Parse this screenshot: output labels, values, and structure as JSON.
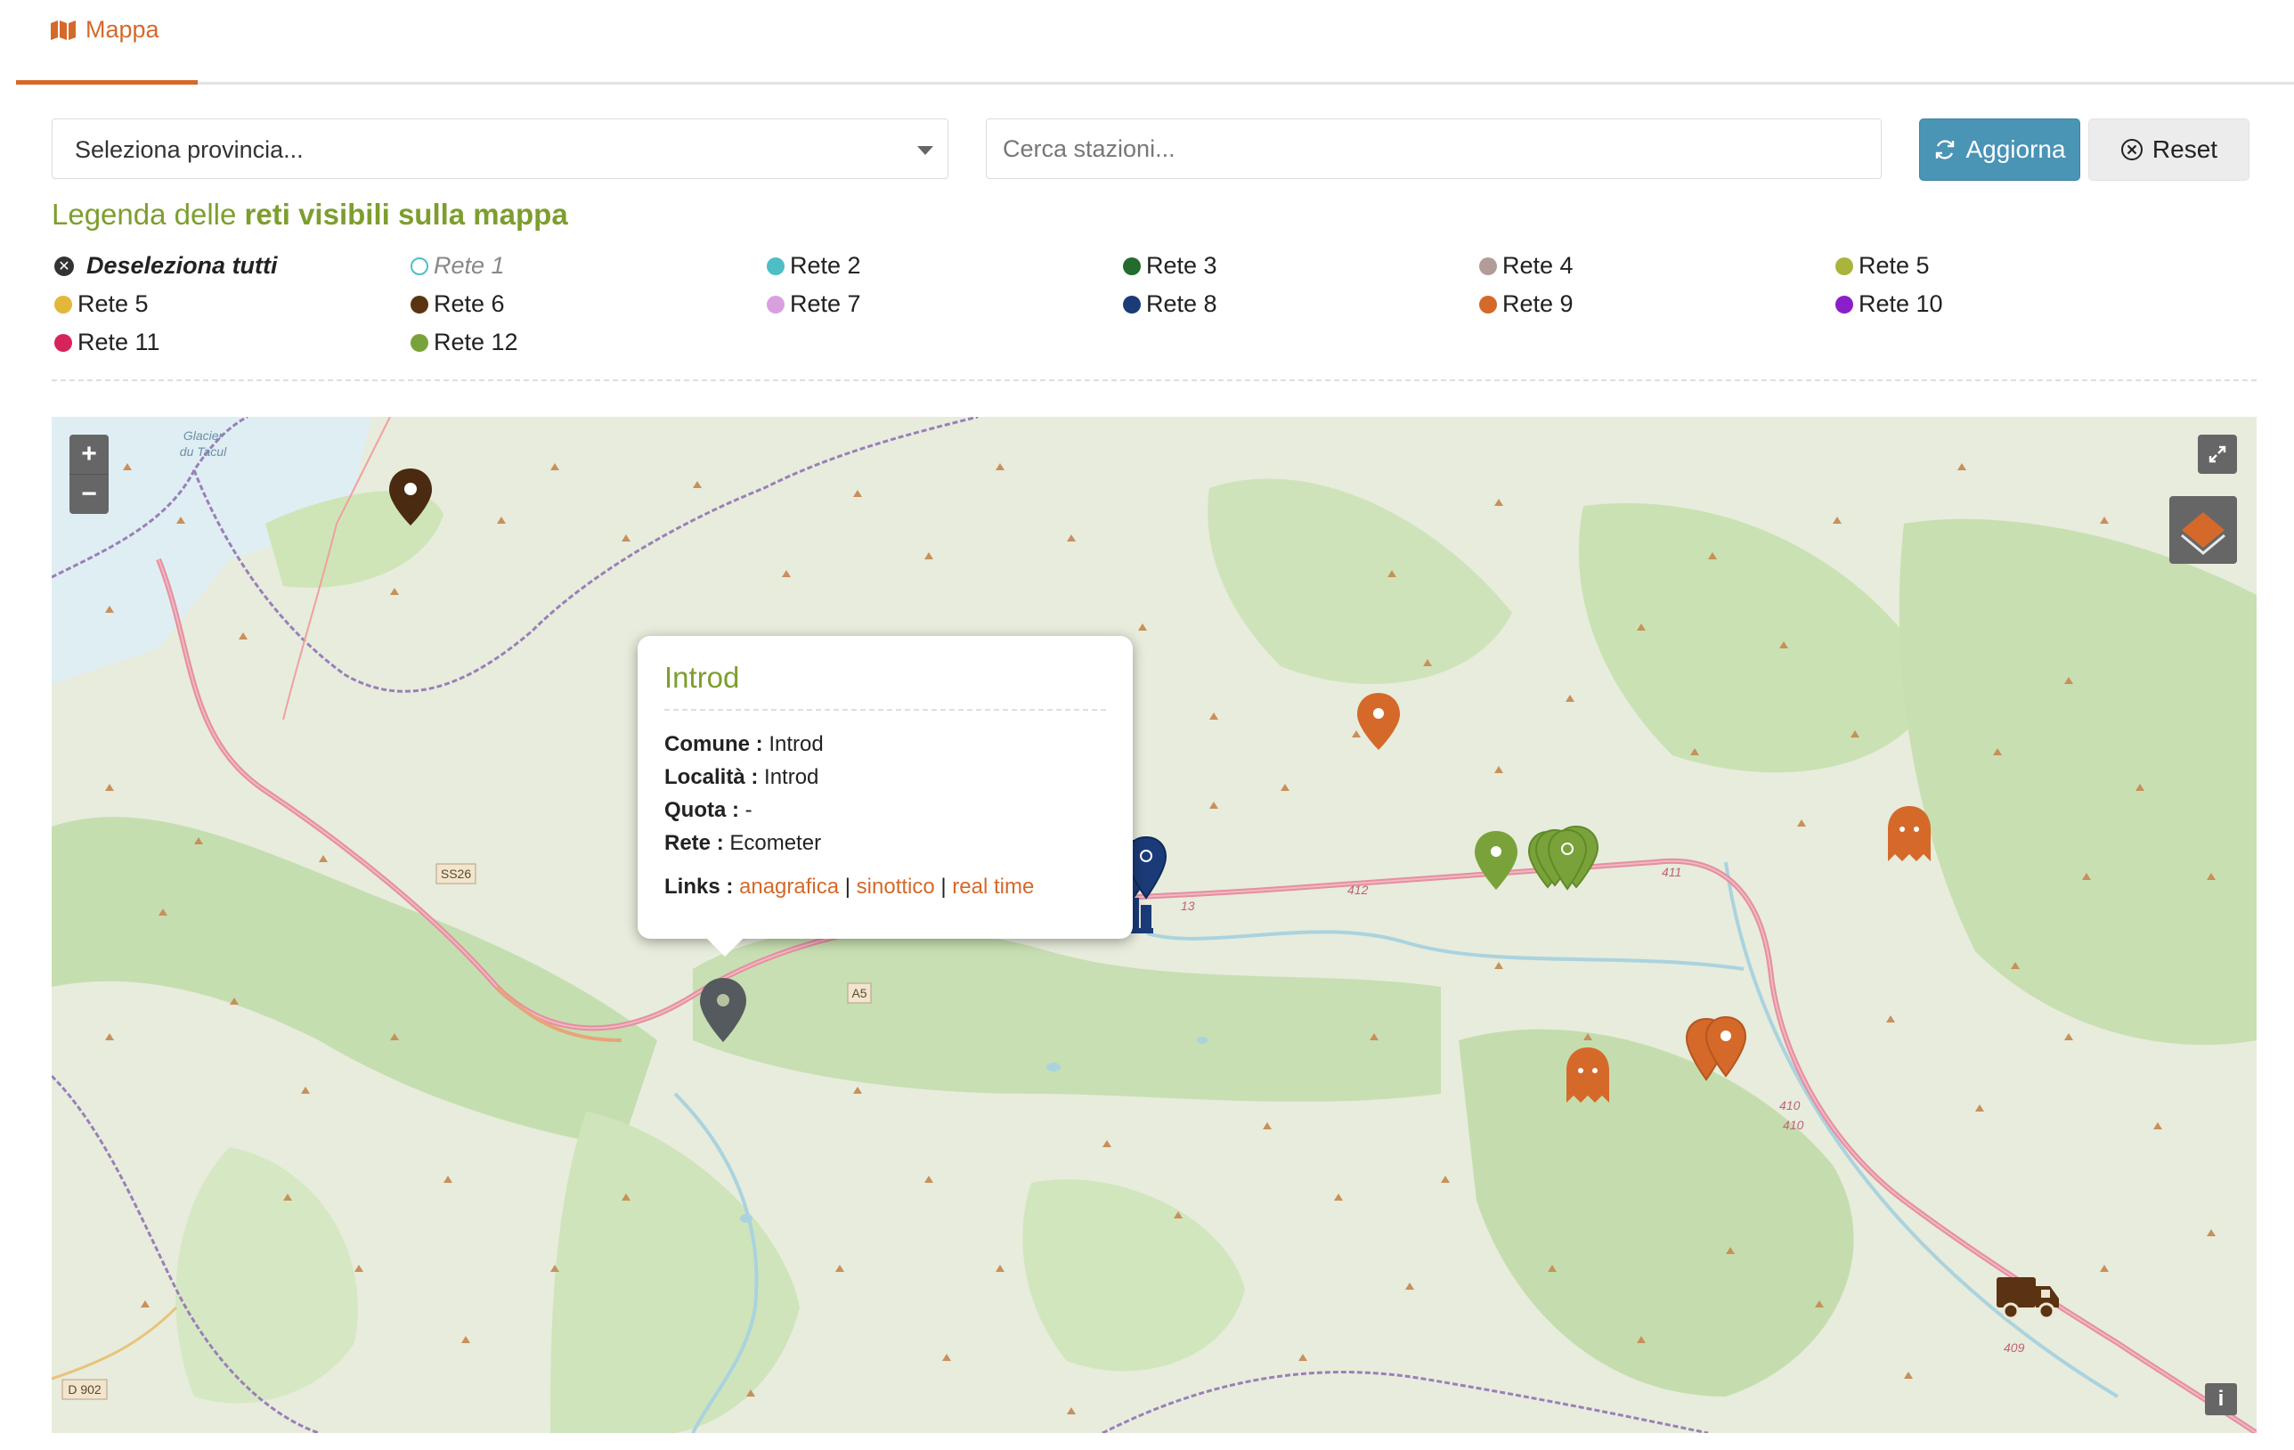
{
  "tab": {
    "label": "Mappa"
  },
  "filters": {
    "province_select": "Seleziona provincia...",
    "search_placeholder": "Cerca stazioni...",
    "update_label": "Aggiorna",
    "reset_label": "Reset"
  },
  "legend": {
    "title_prefix": "Legenda delle",
    "title_bold": "reti visibili sulla mappa",
    "deselect_label": "Deseleziona tutti",
    "items": [
      {
        "label": "Rete 1",
        "color": "#ffffff",
        "active": false
      },
      {
        "label": "Rete 2",
        "color": "#4dbfc4",
        "active": true
      },
      {
        "label": "Rete 3",
        "color": "#246b2e",
        "active": true
      },
      {
        "label": "Rete 4",
        "color": "#b29c98",
        "active": true
      },
      {
        "label": "Rete 5",
        "color": "#a9b43a",
        "active": true
      },
      {
        "label": "Rete 5",
        "color": "#e2b73a",
        "active": true
      },
      {
        "label": "Rete 6",
        "color": "#5a3312",
        "active": true
      },
      {
        "label": "Rete 7",
        "color": "#d9a0e0",
        "active": true
      },
      {
        "label": "Rete 8",
        "color": "#1a3b78",
        "active": true
      },
      {
        "label": "Rete 9",
        "color": "#d5692a",
        "active": true
      },
      {
        "label": "Rete 10",
        "color": "#8a1fc9",
        "active": true
      },
      {
        "label": "Rete 11",
        "color": "#d6245a",
        "active": true
      },
      {
        "label": "Rete 12",
        "color": "#79a33a",
        "active": true
      }
    ]
  },
  "map": {
    "road_labels": [
      "SS26",
      "A5",
      "412",
      "411",
      "410",
      "410",
      "409",
      "D 902",
      "13"
    ],
    "place_labels": [
      "Glacier",
      "du Tacul"
    ],
    "controls": {
      "zoom_in": "+",
      "zoom_out": "−",
      "info": "i"
    },
    "popup": {
      "title": "Introd",
      "comune_label": "Comune :",
      "comune": "Introd",
      "localita_label": "Località :",
      "localita": "Introd",
      "quota_label": "Quota :",
      "quota": "-",
      "rete_label": "Rete :",
      "rete": "Ecometer",
      "links_label": "Links :",
      "links": [
        "anagrafica",
        "sinottico",
        "real time"
      ],
      "separator": "|"
    }
  }
}
